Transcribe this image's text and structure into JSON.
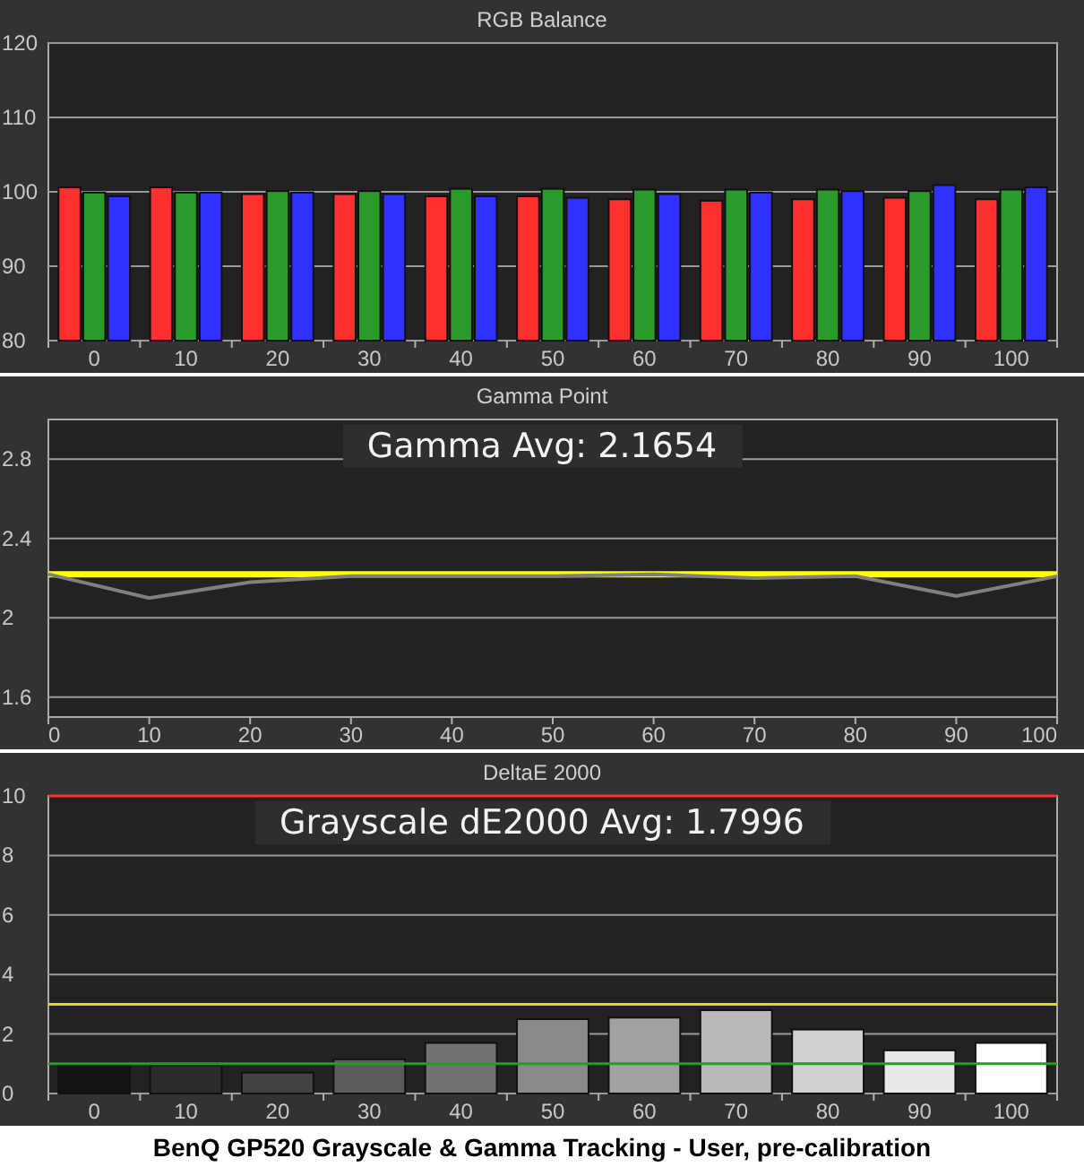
{
  "charts": [
    {
      "chart_data": {
        "type": "bar",
        "title": "RGB Balance",
        "categories": [
          "0",
          "10",
          "20",
          "30",
          "40",
          "50",
          "60",
          "70",
          "80",
          "90",
          "100"
        ],
        "series": [
          {
            "color": "#ff3030",
            "values": [
              100.6,
              100.6,
              99.7,
              99.7,
              99.4,
              99.4,
              99.0,
              98.8,
              99.0,
              99.2,
              99.0
            ]
          },
          {
            "color": "#2a9a2a",
            "values": [
              99.9,
              99.9,
              100.1,
              100.1,
              100.4,
              100.4,
              100.3,
              100.3,
              100.3,
              100.1,
              100.3
            ]
          },
          {
            "color": "#3030ff",
            "values": [
              99.4,
              99.9,
              99.9,
              99.7,
              99.4,
              99.2,
              99.7,
              99.9,
              100.1,
              100.9,
              100.6
            ]
          }
        ],
        "ylim": [
          80,
          120
        ],
        "yticks": [
          80,
          90,
          100,
          110,
          120
        ],
        "grid": true
      }
    },
    {
      "chart_data": {
        "type": "line",
        "title": "Gamma Point",
        "x": [
          0,
          10,
          20,
          30,
          40,
          50,
          60,
          70,
          80,
          90,
          100
        ],
        "series": [
          {
            "color": "#ffff00",
            "values": [
              2.22,
              2.22,
              2.22,
              2.22,
              2.22,
              2.22,
              2.22,
              2.22,
              2.22,
              2.22,
              2.22
            ]
          },
          {
            "color": "#808080",
            "values": [
              2.22,
              2.1,
              2.18,
              2.21,
              2.21,
              2.21,
              2.22,
              2.2,
              2.21,
              2.11,
              2.21
            ]
          }
        ],
        "xlim": [
          0,
          100
        ],
        "ylim": [
          1.5,
          3.0
        ],
        "xticks": [
          0,
          10,
          20,
          30,
          40,
          50,
          60,
          70,
          80,
          90,
          100
        ],
        "yticks": [
          {
            "value": 1.6,
            "label": "1.6"
          },
          {
            "value": 2,
            "label": "2"
          },
          {
            "value": 2.4,
            "label": "2.4"
          },
          {
            "value": 2.8,
            "label": "2.8"
          }
        ],
        "grid": true,
        "annotations": [
          {
            "text": "Gamma Avg: 2.1654"
          }
        ]
      }
    },
    {
      "chart_data": {
        "type": "bar",
        "title": "DeltaE 2000",
        "categories": [
          "0",
          "10",
          "20",
          "30",
          "40",
          "50",
          "60",
          "70",
          "80",
          "90",
          "100"
        ],
        "series": [
          {
            "values": [
              1.0,
              0.95,
              0.7,
              1.15,
              1.7,
              2.5,
              2.55,
              2.8,
              2.15,
              1.45,
              1.7
            ]
          }
        ],
        "ylim": [
          0,
          10
        ],
        "yticks": [
          0,
          2,
          4,
          6,
          8,
          10
        ],
        "grid": true,
        "ref_lines": [
          {
            "axis": "y",
            "value": 10,
            "color": "#ff3030"
          },
          {
            "axis": "y",
            "value": 3,
            "color": "#e0e000"
          },
          {
            "axis": "y",
            "value": 1,
            "color": "#20a020"
          }
        ],
        "annotations": [
          {
            "text": "Grayscale dE2000 Avg: 1.7996"
          }
        ]
      }
    }
  ],
  "caption": "BenQ GP520 Grayscale & Gamma Tracking - User, pre-calibration"
}
